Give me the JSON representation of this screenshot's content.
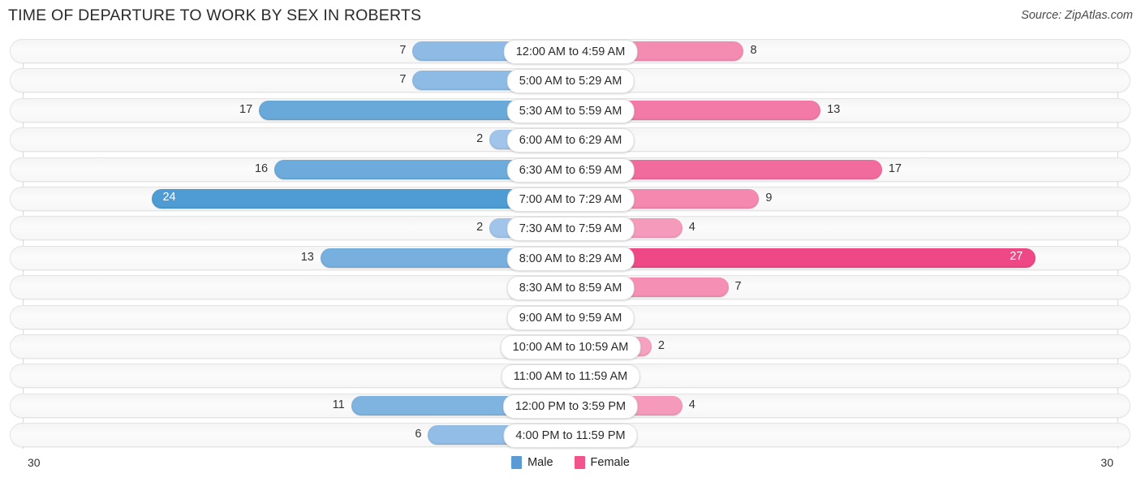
{
  "header": {
    "title": "TIME OF DEPARTURE TO WORK BY SEX IN ROBERTS",
    "source": "Source: ZipAtlas.com"
  },
  "legend": {
    "male_label": "Male",
    "female_label": "Female",
    "male_color": "#5B9BD5",
    "female_color": "#F2538A"
  },
  "axis": {
    "left_end": "30",
    "right_end": "30"
  },
  "chart_data": {
    "type": "bar",
    "title": "TIME OF DEPARTURE TO WORK BY SEX IN ROBERTS",
    "subtitle": "",
    "orientation": "horizontal-diverging",
    "xlabel": "",
    "ylabel": "",
    "xlim": [
      30,
      30
    ],
    "grid": false,
    "legend_position": "bottom-center",
    "categories": [
      "12:00 AM to 4:59 AM",
      "5:00 AM to 5:29 AM",
      "5:30 AM to 5:59 AM",
      "6:00 AM to 6:29 AM",
      "6:30 AM to 6:59 AM",
      "7:00 AM to 7:29 AM",
      "7:30 AM to 7:59 AM",
      "8:00 AM to 8:29 AM",
      "8:30 AM to 8:59 AM",
      "9:00 AM to 9:59 AM",
      "10:00 AM to 10:59 AM",
      "11:00 AM to 11:59 AM",
      "12:00 PM to 3:59 PM",
      "4:00 PM to 11:59 PM"
    ],
    "series": [
      {
        "name": "Male",
        "color": "#5B9BD5",
        "values": [
          7,
          7,
          17,
          2,
          16,
          24,
          2,
          13,
          0,
          0,
          0,
          0,
          11,
          6
        ]
      },
      {
        "name": "Female",
        "color": "#F2538A",
        "values": [
          8,
          0,
          13,
          0,
          17,
          9,
          4,
          27,
          7,
          0,
          2,
          0,
          4,
          0
        ]
      }
    ]
  },
  "rows": [
    {
      "label": "12:00 AM to 4:59 AM",
      "male": "7",
      "female": "8",
      "male_inside": false,
      "female_inside": false
    },
    {
      "label": "5:00 AM to 5:29 AM",
      "male": "7",
      "female": "0",
      "male_inside": false,
      "female_inside": false
    },
    {
      "label": "5:30 AM to 5:59 AM",
      "male": "17",
      "female": "13",
      "male_inside": false,
      "female_inside": false
    },
    {
      "label": "6:00 AM to 6:29 AM",
      "male": "2",
      "female": "0",
      "male_inside": false,
      "female_inside": false
    },
    {
      "label": "6:30 AM to 6:59 AM",
      "male": "16",
      "female": "17",
      "male_inside": false,
      "female_inside": false
    },
    {
      "label": "7:00 AM to 7:29 AM",
      "male": "24",
      "female": "9",
      "male_inside": true,
      "female_inside": false
    },
    {
      "label": "7:30 AM to 7:59 AM",
      "male": "2",
      "female": "4",
      "male_inside": false,
      "female_inside": false
    },
    {
      "label": "8:00 AM to 8:29 AM",
      "male": "13",
      "female": "27",
      "male_inside": false,
      "female_inside": true
    },
    {
      "label": "8:30 AM to 8:59 AM",
      "male": "0",
      "female": "7",
      "male_inside": false,
      "female_inside": false
    },
    {
      "label": "9:00 AM to 9:59 AM",
      "male": "0",
      "female": "0",
      "male_inside": false,
      "female_inside": false
    },
    {
      "label": "10:00 AM to 10:59 AM",
      "male": "0",
      "female": "2",
      "male_inside": false,
      "female_inside": false
    },
    {
      "label": "11:00 AM to 11:59 AM",
      "male": "0",
      "female": "0",
      "male_inside": false,
      "female_inside": false
    },
    {
      "label": "12:00 PM to 3:59 PM",
      "male": "11",
      "female": "4",
      "male_inside": false,
      "female_inside": false
    },
    {
      "label": "4:00 PM to 11:59 PM",
      "male": "6",
      "female": "0",
      "male_inside": false,
      "female_inside": false
    }
  ]
}
